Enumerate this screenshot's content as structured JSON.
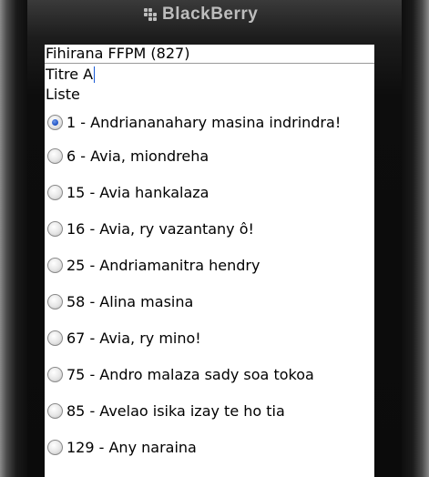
{
  "device": {
    "brand": "BlackBerry"
  },
  "app": {
    "title": "Fihirana FFPM (827)",
    "title_field_value": "Titre A",
    "list_label": "Liste"
  },
  "hymns": [
    {
      "label": "1 - Andriananahary masina indrindra!",
      "selected": true
    },
    {
      "label": "6 - Avia, miondreha",
      "selected": false
    },
    {
      "label": "15 - Avia hankalaza",
      "selected": false
    },
    {
      "label": "16 - Avia, ry vazantany ô!",
      "selected": false
    },
    {
      "label": "25 - Andriamanitra hendry",
      "selected": false
    },
    {
      "label": "58 - Alina masina",
      "selected": false
    },
    {
      "label": "67 - Avia, ry mino!",
      "selected": false
    },
    {
      "label": "75 - Andro malaza sady soa tokoa",
      "selected": false
    },
    {
      "label": "85 - Avelao isika izay te ho tia",
      "selected": false
    },
    {
      "label": "129 - Any naraina",
      "selected": false
    }
  ],
  "colors": {
    "accent": "#1b4fc4",
    "screen_bg": "#ffffff",
    "device_body": "#0b0b0b"
  }
}
